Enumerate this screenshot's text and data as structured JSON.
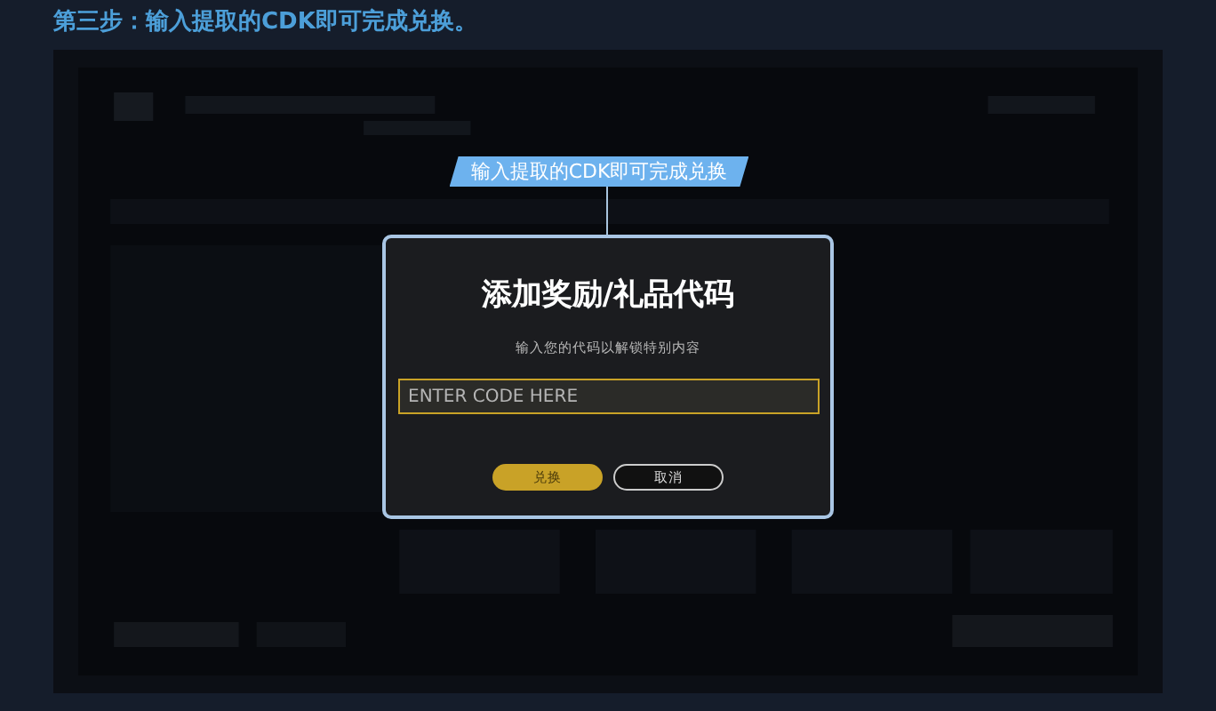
{
  "heading": "第三步：输入提取的CDK即可完成兑换。",
  "callout": "输入提取的CDK即可完成兑换",
  "dialog": {
    "title": "添加奖励/礼品代码",
    "subtitle": "输入您的代码以解锁特别内容",
    "code_field": {
      "placeholder": "ENTER CODE HERE"
    },
    "buttons": [
      {
        "label": "兑换",
        "kind": "primary"
      },
      {
        "label": "取消",
        "kind": "secondary"
      }
    ]
  }
}
